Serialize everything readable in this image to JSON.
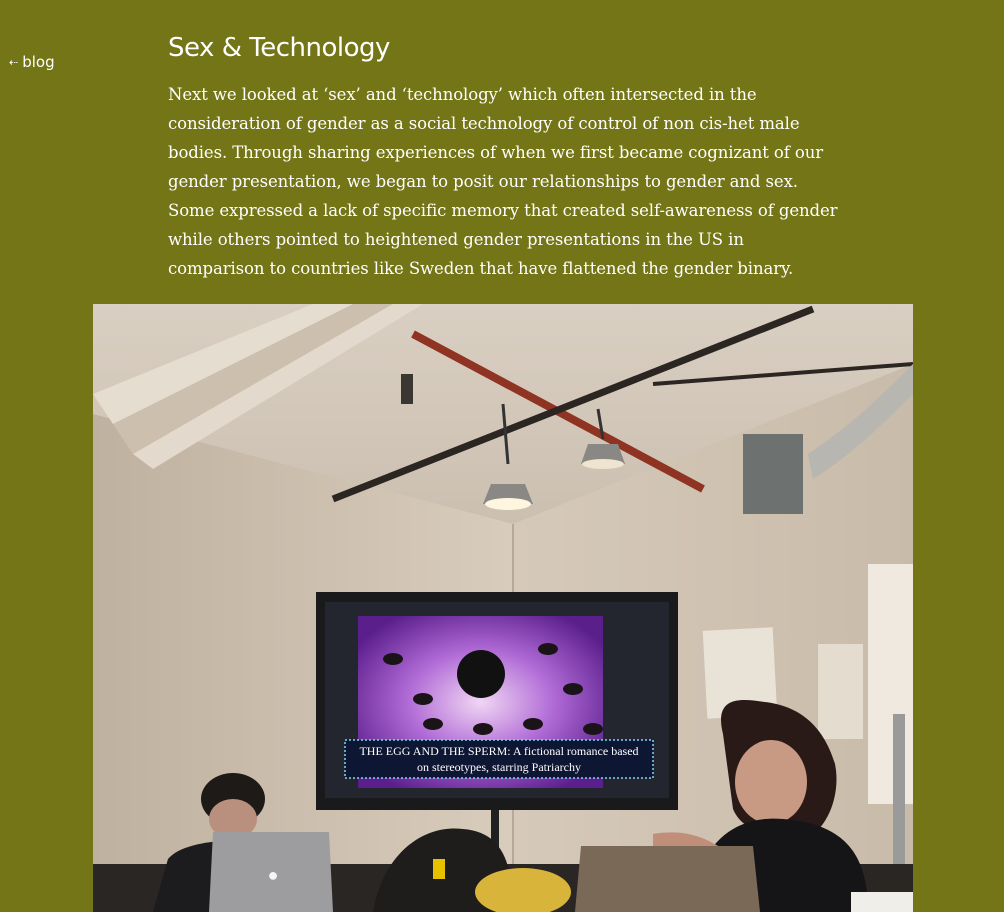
{
  "nav": {
    "back_label": "blog"
  },
  "article": {
    "title": "Sex & Technology",
    "body": "Next we looked at ‘sex’ and ‘technology’ which often intersected in the consideration of gender as a social technology of control of non cis-het male bodies. Through sharing experiences of when we first became cognizant of our gender presentation, we began to posit our relationships to gender and sex. Some expressed a lack of specific memory that created self-awareness of gender while others pointed to heightened gender presentations in the US in comparison to countries like Sweden that have flattened the gender binary."
  },
  "photo": {
    "screen_caption_line1": "THE EGG AND THE SPERM: A fictional romance based",
    "screen_caption_line2": "on stereotypes, starring Patriarchy"
  },
  "colors": {
    "background": "#737516",
    "text": "#ffffff"
  }
}
